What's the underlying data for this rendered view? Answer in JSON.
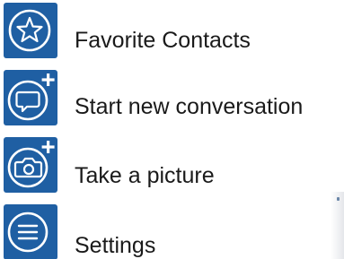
{
  "menu": {
    "items": [
      {
        "label": "Favorite Contacts",
        "icon": "star-icon"
      },
      {
        "label": "Start new conversation",
        "icon": "new-conversation-icon"
      },
      {
        "label": "Take a picture",
        "icon": "add-photo-icon"
      },
      {
        "label": "Settings",
        "icon": "menu-lines-icon"
      }
    ]
  },
  "colors": {
    "icon_tile": "#1f5fa3",
    "icon_glyph": "#ffffff",
    "text": "#1a1a1a",
    "background": "#ffffff"
  }
}
